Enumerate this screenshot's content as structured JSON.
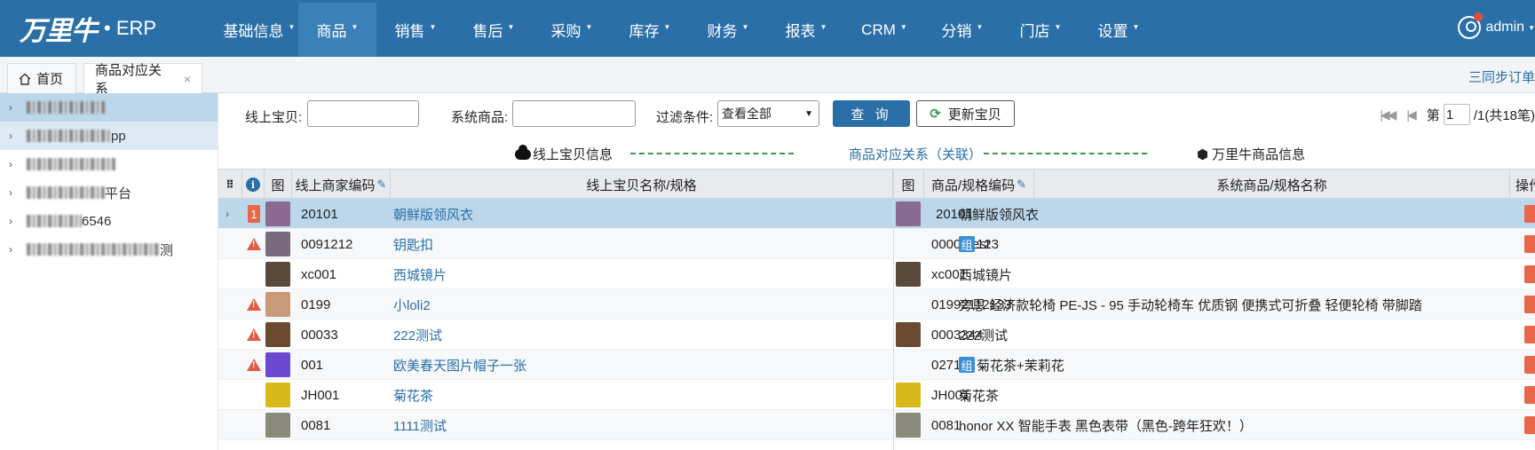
{
  "app": {
    "logo": "万里牛",
    "erp": "• ERP"
  },
  "nav": [
    {
      "label": "基础信息"
    },
    {
      "label": "商品"
    },
    {
      "label": "销售"
    },
    {
      "label": "售后"
    },
    {
      "label": "采购"
    },
    {
      "label": "库存"
    },
    {
      "label": "财务"
    },
    {
      "label": "报表"
    },
    {
      "label": "CRM"
    },
    {
      "label": "分销"
    },
    {
      "label": "门店"
    },
    {
      "label": "设置"
    }
  ],
  "nav_active": "商品",
  "user": {
    "name": "admin"
  },
  "tabs": {
    "home": "首页",
    "current": "商品对应关系",
    "close": "×"
  },
  "sync_label": "三同步订单",
  "sidebar": [
    {
      "suffix": ""
    },
    {
      "suffix": "pp"
    },
    {
      "suffix": ""
    },
    {
      "suffix": "平台"
    },
    {
      "suffix": "6546"
    },
    {
      "suffix": "测"
    }
  ],
  "filter": {
    "online_label": "线上宝贝:",
    "online_value": "",
    "system_label": "系统商品:",
    "system_value": "",
    "condition_label": "过滤条件:",
    "condition_value": "查看全部",
    "query_button": "查 询",
    "update_button": "更新宝贝"
  },
  "pager": {
    "prefix": "第",
    "page": "1",
    "suffix": "/1(共18笔)"
  },
  "legend": {
    "online_info": "线上宝贝信息",
    "relation": "商品对应关系（关联）",
    "system_info": "万里牛商品信息"
  },
  "columns": {
    "img1": "图",
    "online_code": "线上商家编码",
    "online_name": "线上宝贝名称/规格",
    "img2": "图",
    "sku_code": "商品/规格编码",
    "sys_name": "系统商品/规格名称",
    "op": "操作"
  },
  "rows": [
    {
      "flag": "1",
      "code": "20101",
      "name": "朝鲜版领风衣",
      "sku": "20101",
      "sys": "朝鲜版领风衣",
      "zu": false
    },
    {
      "flag": "warn",
      "code": "0091212",
      "name": "钥匙扣",
      "sku": "00003test",
      "sys": "123",
      "zu": true
    },
    {
      "flag": "",
      "code": "xc001",
      "name": "西城镜片",
      "sku": "xc001",
      "sys": "西城镜片",
      "zu": false
    },
    {
      "flag": "warn",
      "code": "0199",
      "name": "小loli2",
      "sku": "01992112133",
      "sys": "旁恩 经济款轮椅 PE-JS - 95 手动轮椅车 优质钢 便携式可折叠 轻便轮椅 带脚踏",
      "zu": false
    },
    {
      "flag": "warn",
      "code": "00033",
      "name": "222测试",
      "sku": "0003344",
      "sys": "222测试",
      "zu": false
    },
    {
      "flag": "warn",
      "code": "001",
      "name": "欧美春天图片帽子一张",
      "sku": "0271",
      "sys": "菊花茶+茉莉花",
      "zu": true
    },
    {
      "flag": "",
      "code": "JH001",
      "name": "菊花茶",
      "sku": "JH001",
      "sys": "菊花茶",
      "zu": false
    },
    {
      "flag": "",
      "code": "0081",
      "name": "1111测试",
      "sku": "0081",
      "sys": "honor XX 智能手表 黑色表带（黑色-跨年狂欢！）",
      "zu": false
    }
  ],
  "zu_label": "组",
  "colors": {
    "nav": "#2a6fa8",
    "highlight": "#bcd6ea",
    "warn": "#e05c45",
    "link": "#2a6fa8"
  }
}
